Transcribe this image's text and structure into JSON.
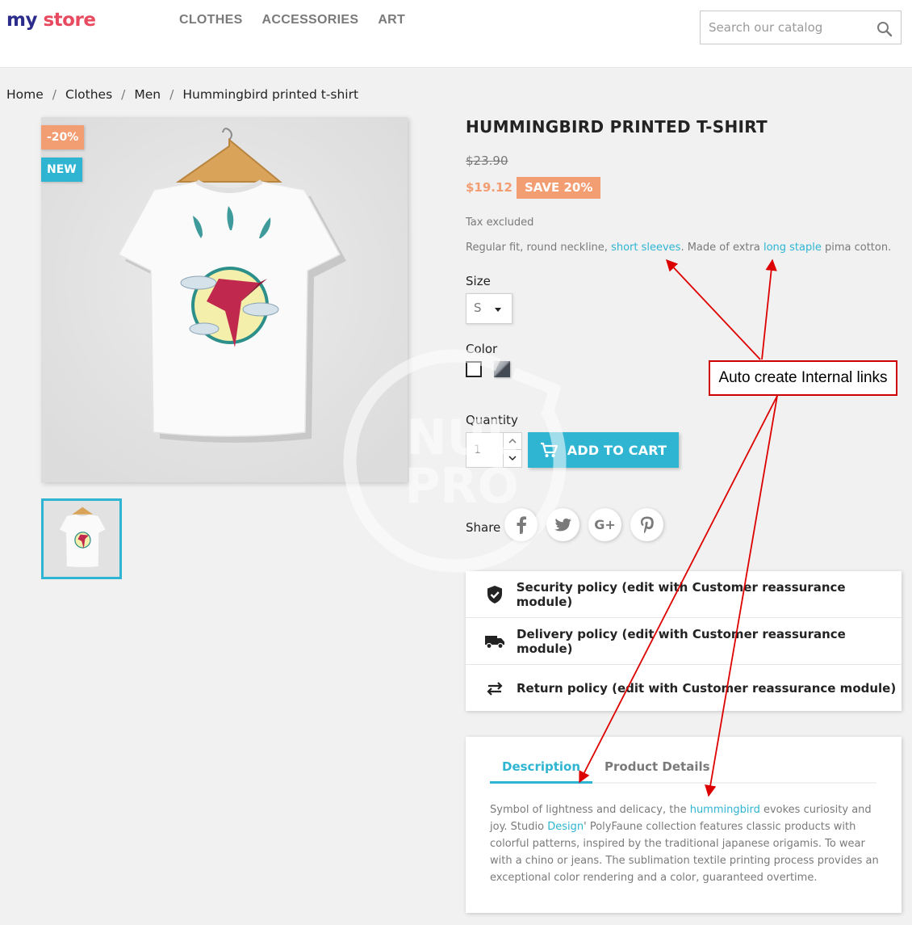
{
  "logo": {
    "my": "my",
    "store": "store"
  },
  "nav": [
    "CLOTHES",
    "ACCESSORIES",
    "ART"
  ],
  "search": {
    "placeholder": "Search our catalog",
    "value": ""
  },
  "breadcrumb": [
    "Home",
    "Clothes",
    "Men",
    "Hummingbird printed t-shirt"
  ],
  "product": {
    "flags": {
      "discount": "-20%",
      "new": "NEW"
    },
    "title": "HUMMINGBIRD PRINTED T-SHIRT",
    "regular_price": "$23.90",
    "price": "$19.12",
    "save": "SAVE 20%",
    "tax": "Tax excluded",
    "short_desc": {
      "part1": "Regular fit, round neckline, ",
      "link1": "short sleeves",
      "part2": ". Made of extra ",
      "link2": "long staple",
      "part3": " pima cotton."
    },
    "size_label": "Size",
    "size_value": "S",
    "color_label": "Color",
    "colors": [
      "white",
      "black"
    ],
    "quantity_label": "Quantity",
    "quantity_value": "1",
    "add_to_cart": "ADD TO CART",
    "share_label": "Share",
    "social": [
      "facebook",
      "twitter",
      "google-plus",
      "pinterest"
    ]
  },
  "reassurance": [
    {
      "icon": "shield-check-icon",
      "text": "Security policy (edit with Customer reassurance module)"
    },
    {
      "icon": "truck-icon",
      "text": "Delivery policy (edit with Customer reassurance module)"
    },
    {
      "icon": "swap-arrows-icon",
      "text": "Return policy (edit with Customer reassurance module)"
    }
  ],
  "tabs": [
    "Description",
    "Product Details"
  ],
  "description": {
    "p1": "Symbol of lightness and delicacy, the ",
    "link1": "hummingbird",
    "p2": " evokes curiosity and joy. Studio ",
    "link2": "Design",
    "p3": "' PolyFaune collection features classic products with colorful patterns, inspired by the traditional japanese origamis. To wear with a chino or jeans. The sublimation textile printing process provides an exceptional color rendering and a color, guaranteed overtime."
  },
  "annotation": {
    "callout": "Auto create Internal links",
    "color": "#cc0000"
  },
  "watermark": {
    "line1": "NUL",
    "line2": "PRO"
  },
  "colors": {
    "accent": "#2fb5d2",
    "discount": "#f39d72",
    "text": "#232323",
    "muted": "#7a7a7a"
  }
}
